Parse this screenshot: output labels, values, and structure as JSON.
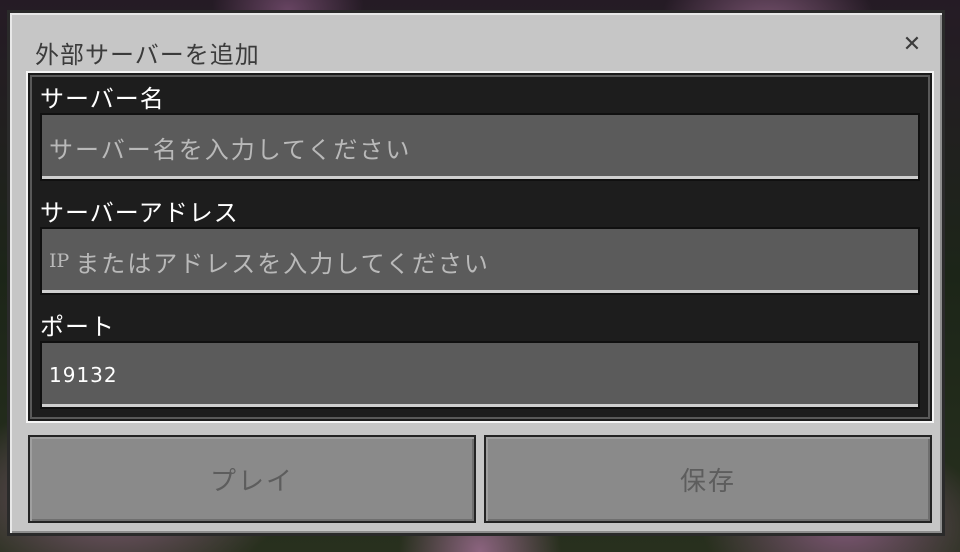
{
  "dialog": {
    "title": "外部サーバーを追加",
    "close_icon": "close-icon"
  },
  "fields": {
    "server_name": {
      "label": "サーバー名",
      "placeholder": "サーバー名を入力してください",
      "value": ""
    },
    "server_address": {
      "label": "サーバーアドレス",
      "placeholder_prefix": "IP",
      "placeholder": "またはアドレスを入力してください",
      "value": ""
    },
    "port": {
      "label": "ポート",
      "value": "19132"
    }
  },
  "buttons": {
    "play_label": "プレイ",
    "save_label": "保存"
  },
  "colors": {
    "dialog_bg": "#c6c6c6",
    "form_bg": "#0a0a0a",
    "input_bg": "#5b5b5b",
    "button_disabled_bg": "#8a8a8a",
    "button_disabled_text": "#5d5d5d"
  }
}
